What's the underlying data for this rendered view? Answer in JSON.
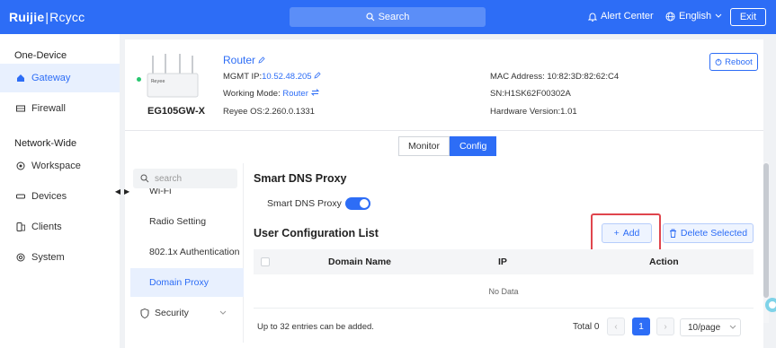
{
  "topbar": {
    "logo_brand": "Ruijie",
    "logo_sep": "|",
    "logo_sub": "Rcycc",
    "search_label": "Search",
    "alert_label": "Alert Center",
    "lang_label": "English",
    "exit_label": "Exit"
  },
  "sidebar": {
    "section1": "One-Device",
    "section2": "Network-Wide",
    "items": [
      {
        "label": "Gateway"
      },
      {
        "label": "Firewall"
      },
      {
        "label": "Workspace"
      },
      {
        "label": "Devices"
      },
      {
        "label": "Clients"
      },
      {
        "label": "System"
      }
    ]
  },
  "device": {
    "model": "EG105GW-X",
    "name": "Router",
    "mgmt_ip_label": "MGMT IP:",
    "mgmt_ip": "10.52.48.205",
    "working_mode_label": "Working Mode:",
    "working_mode": "Router",
    "os": "Reyee OS:2.260.0.1331",
    "mac": "MAC Address: 10:82:3D:82:62:C4",
    "sn": "SN:H1SK62F00302A",
    "hw": "Hardware Version:1.01",
    "reboot_label": "Reboot",
    "image_brand": "Reyee"
  },
  "tabs": [
    {
      "label": "Monitor"
    },
    {
      "label": "Config"
    }
  ],
  "subnav": {
    "search_placeholder": "search",
    "items": [
      {
        "label": "Wi-Fi"
      },
      {
        "label": "Radio Setting"
      },
      {
        "label": "802.1x Authentication"
      },
      {
        "label": "Domain Proxy"
      },
      {
        "label": "Security"
      }
    ]
  },
  "content": {
    "section_title": "Smart DNS Proxy",
    "toggle_label": "Smart DNS Proxy",
    "toggle_on": true,
    "list_title": "User Configuration List",
    "add_label": "Add",
    "delete_label": "Delete Selected",
    "columns": [
      "Domain Name",
      "IP",
      "Action"
    ],
    "empty_text": "No Data",
    "footer_note": "Up to 32 entries can be added.",
    "total": "Total 0",
    "current_page": "1",
    "per_page": "10/page"
  },
  "colors": {
    "primary": "#2d6df6",
    "highlight": "#e0454d",
    "online": "#28c76f"
  }
}
